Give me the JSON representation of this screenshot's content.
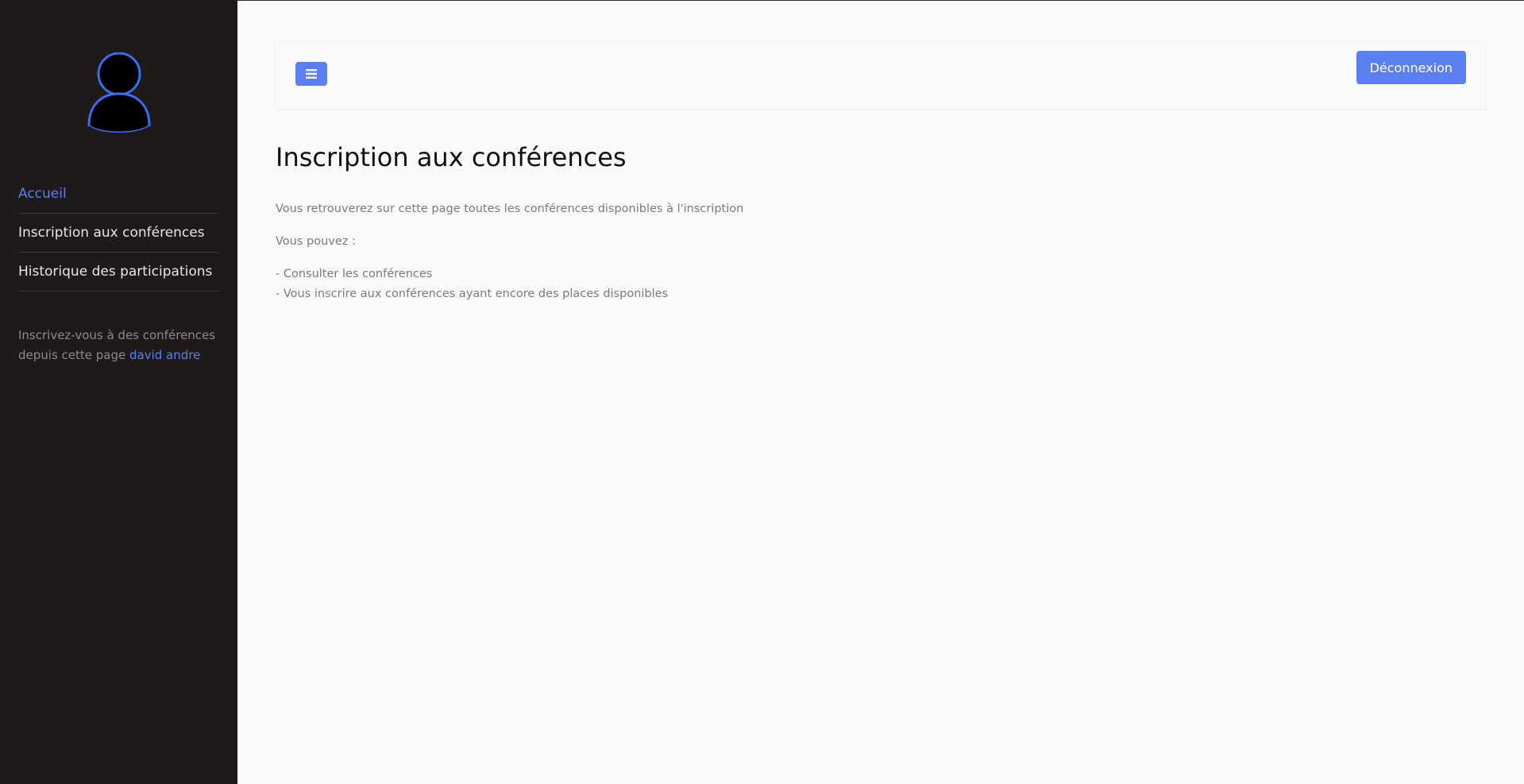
{
  "sidebar": {
    "avatar_icon": "user-icon",
    "nav": [
      {
        "label": "Accueil",
        "active": true
      },
      {
        "label": "Inscription aux conférences",
        "active": false
      },
      {
        "label": "Historique des participations",
        "active": false
      }
    ],
    "footer": {
      "text": "Inscrivez-vous à des conférences depuis cette page ",
      "user_name": "david andre"
    }
  },
  "header": {
    "menu_icon": "hamburger-icon",
    "logout_label": "Déconnexion"
  },
  "main": {
    "title": "Inscription aux conférences",
    "intro": "Vous retrouverez sur cette page toutes les conférences disponibles à l'inscription",
    "can_do_label": "Vous pouvez :",
    "items": [
      "- Consulter les conférences",
      "- Vous inscrire aux conférences ayant encore des places disponibles"
    ]
  },
  "colors": {
    "accent": "#5b7ff0",
    "sidebar_bg": "#1e1a19",
    "page_bg": "#fafafa"
  }
}
